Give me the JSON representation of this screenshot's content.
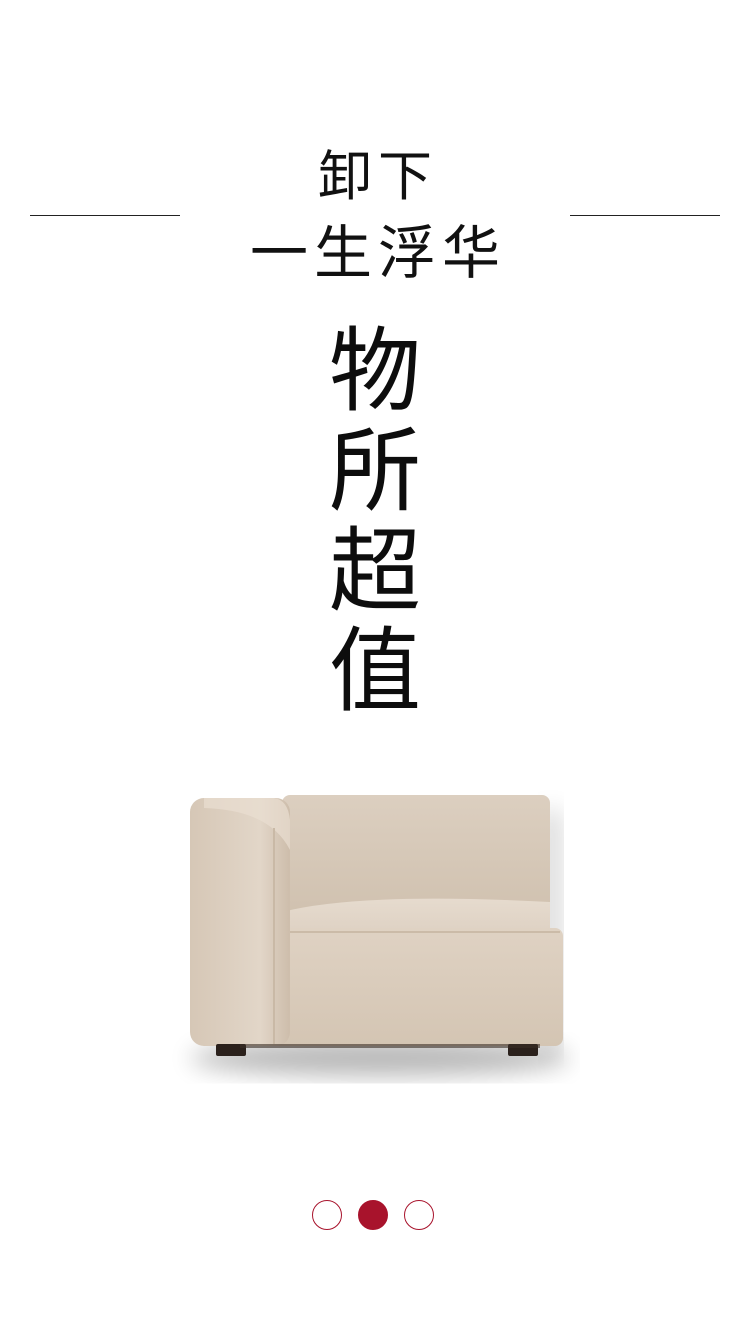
{
  "tagline": {
    "line1": "卸下",
    "line2": "一生浮华"
  },
  "headline": {
    "chars": [
      "物",
      "所",
      "超",
      "值"
    ]
  },
  "product": {
    "icon": "sofa-image",
    "color": "#d9cbbb"
  },
  "pager": {
    "total": 3,
    "active_index": 1,
    "accent_color": "#a8132c"
  }
}
